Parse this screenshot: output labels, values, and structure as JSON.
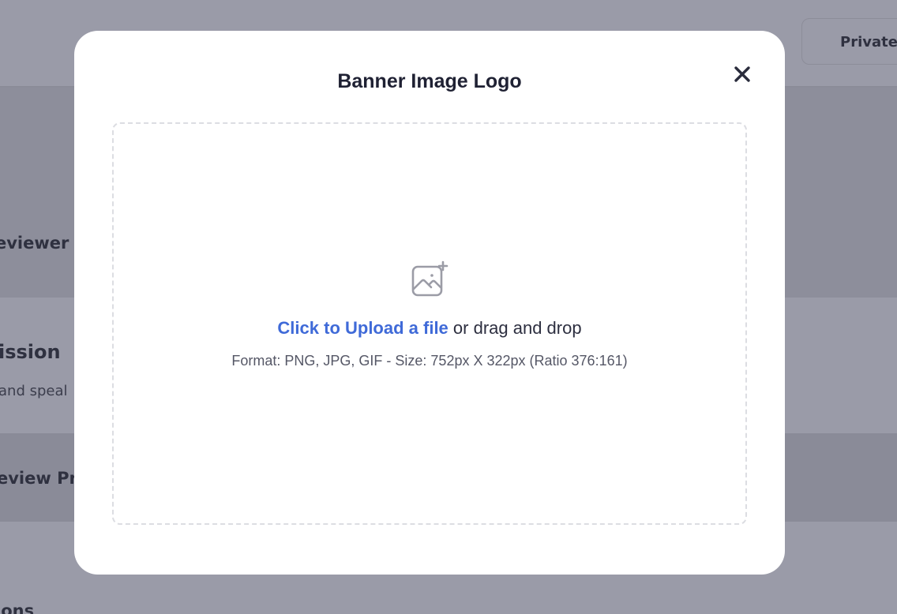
{
  "background": {
    "header_button_label": "Private",
    "fragments": {
      "reviewer": "eviewer",
      "mission": "ission",
      "speak": "and speal",
      "review_pr": "eview Pr",
      "ions": "ions"
    }
  },
  "modal": {
    "title": "Banner Image Logo",
    "close_icon": "close-icon",
    "dropzone": {
      "icon": "image-add-icon",
      "link_text": "Click to Upload a file",
      "rest_text": " or drag and drop",
      "format_text": "Format: PNG, JPG, GIF - Size: 752px X 322px (Ratio 376:161)"
    }
  },
  "colors": {
    "link": "#3f6ad8",
    "overlay": "#8c8d9a",
    "title": "#1f2133"
  }
}
